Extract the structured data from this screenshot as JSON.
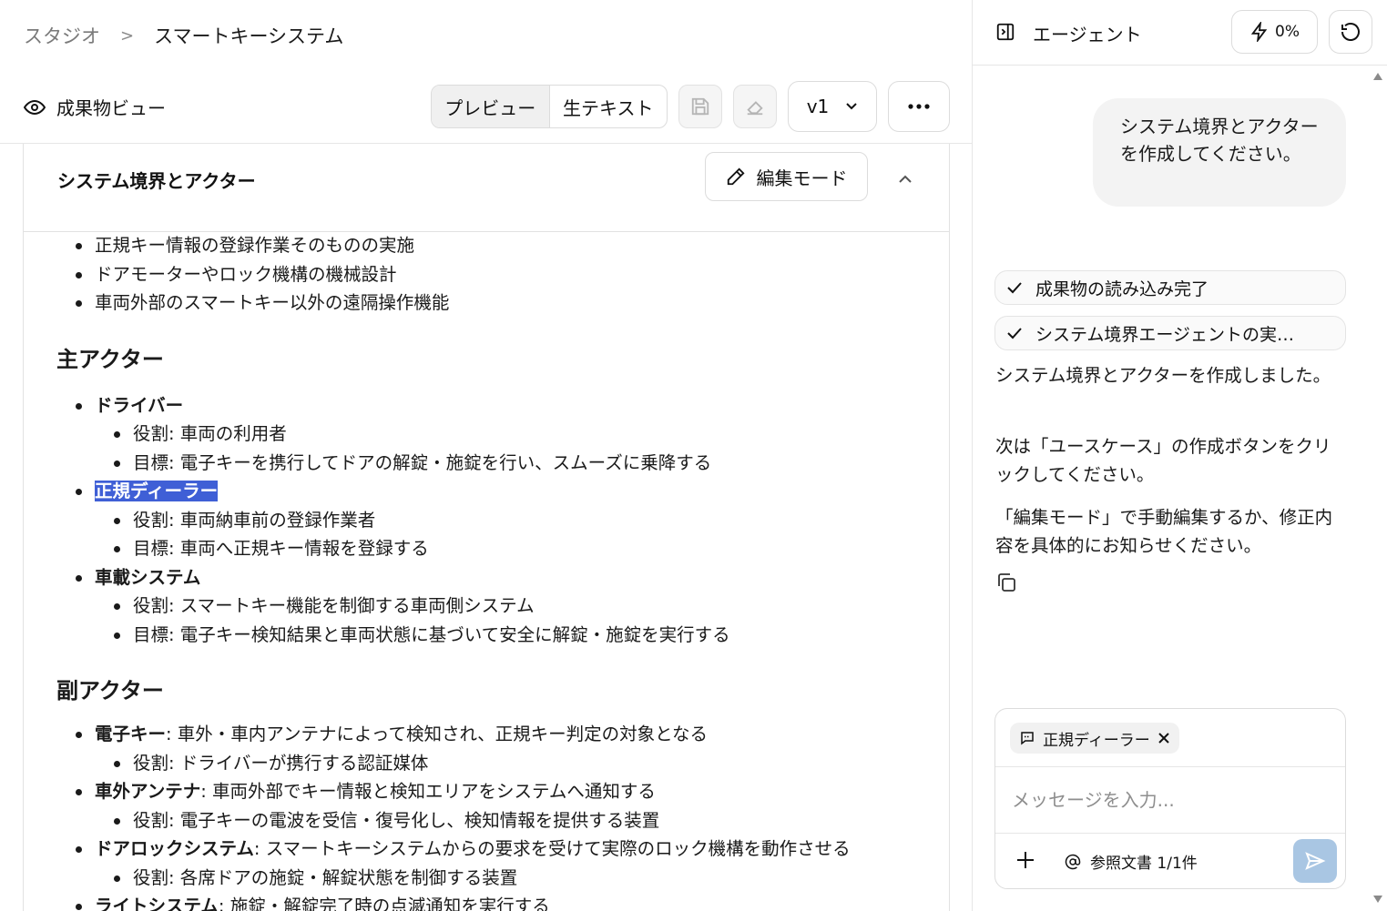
{
  "breadcrumb": {
    "root": "スタジオ",
    "separator": ">",
    "current": "スマートキーシステム"
  },
  "toolbar": {
    "view_title": "成果物ビュー",
    "tabs": [
      {
        "label": "プレビュー",
        "active": true
      },
      {
        "label": "生テキスト",
        "active": false
      }
    ],
    "version": "v1"
  },
  "section": {
    "title": "システム境界とアクター",
    "edit_label": "編集モード"
  },
  "doc": {
    "excluded_items": [
      "正規キー情報の登録作業そのものの実施",
      "ドアモーターやロック機構の機械設計",
      "車両外部のスマートキー以外の遠隔操作機能"
    ],
    "primary_heading": "主アクター",
    "primary": [
      {
        "name": "ドライバー",
        "role": "役割: 車両の利用者",
        "goal": "目標: 電子キーを携行してドアの解錠・施錠を行い、スムーズに乗降する"
      },
      {
        "name": "正規ディーラー",
        "role": "役割: 車両納車前の登録作業者",
        "goal": "目標: 車両へ正規キー情報を登録する"
      },
      {
        "name": "車載システム",
        "role": "役割: スマートキー機能を制御する車両側システム",
        "goal": "目標: 電子キー検知結果と車両状態に基づいて安全に解錠・施錠を実行する"
      }
    ],
    "secondary_heading": "副アクター",
    "secondary": [
      {
        "name": "電子キー",
        "desc": ": 車外・車内アンテナによって検知され、正規キー判定の対象となる",
        "role": "役割: ドライバーが携行する認証媒体"
      },
      {
        "name": "車外アンテナ",
        "desc": ": 車両外部でキー情報と検知エリアをシステムへ通知する",
        "role": "役割: 電子キーの電波を受信・復号化し、検知情報を提供する装置"
      },
      {
        "name": "ドアロックシステム",
        "desc": ": スマートキーシステムからの要求を受けて実際のロック機構を動作させる",
        "role": "役割: 各席ドアの施錠・解錠状態を制御する装置"
      },
      {
        "name": "ライトシステム",
        "desc": ": 施錠・解錠完了時の点滅通知を実行する"
      }
    ]
  },
  "agent": {
    "title": "エージェント",
    "usage": "0%",
    "user_message": "システム境界とアクターを作成してください。",
    "status": [
      "成果物の読み込み完了",
      "システム境界エージェントの実…"
    ],
    "messages": [
      "システム境界とアクターを作成しました。",
      "次は「ユースケース」の作成ボタンをクリックしてください。",
      "「編集モード」で手動編集するか、修正内容を具体的にお知らせください。"
    ],
    "composer": {
      "chip": "正規ディーラー",
      "placeholder": "メッセージを入力...",
      "references": "参照文書 1/1件"
    }
  },
  "colors": {
    "highlight": "#3f5fd6",
    "send_button": "#a9c6e3"
  }
}
